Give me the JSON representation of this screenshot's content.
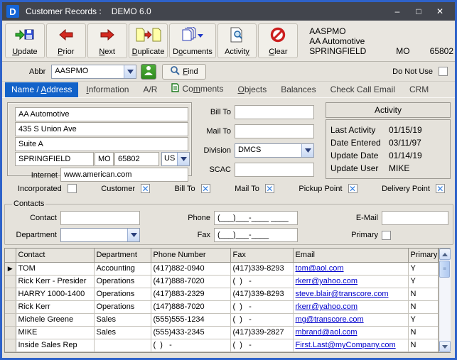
{
  "window": {
    "title": "Customer Records :",
    "product": "DEMO 6.0"
  },
  "titlebar_buttons": {
    "minimize": "–",
    "maximize": "□",
    "close": "✕"
  },
  "toolbar": {
    "buttons": [
      {
        "label": "Update"
      },
      {
        "label": "Prior"
      },
      {
        "label": "Next"
      },
      {
        "label": "Duplicate"
      },
      {
        "label": "Documents"
      },
      {
        "label": "Activity"
      },
      {
        "label": "Clear"
      }
    ],
    "record_info": {
      "abbr": "AASPMO",
      "name": "AA Automotive",
      "city": "SPRINGFIELD",
      "state": "MO",
      "zip": "65802"
    }
  },
  "abbr_bar": {
    "label": "Abbr",
    "value": "AASPMO",
    "find_label": "Find",
    "do_not_use_label": "Do Not Use",
    "do_not_use_checked": false
  },
  "tabs": [
    {
      "label": "Name / Address",
      "selected": true
    },
    {
      "label": "Information"
    },
    {
      "label": "A/R"
    },
    {
      "label": "Comments"
    },
    {
      "label": "Objects"
    },
    {
      "label": "Balances"
    },
    {
      "label": "Check Call Email"
    },
    {
      "label": "CRM"
    }
  ],
  "address": {
    "name": "AA Automotive",
    "line1": "435 S Union Ave",
    "line2": "Suite A",
    "city": "SPRINGFIELD",
    "state": "MO",
    "zip": "65802",
    "country": "US",
    "internet_label": "Internet",
    "internet": "www.american.com"
  },
  "details": {
    "bill_to_label": "Bill To",
    "bill_to": "",
    "mail_to_label": "Mail To",
    "mail_to": "",
    "division_label": "Division",
    "division": "DMCS",
    "scac_label": "SCAC",
    "scac": ""
  },
  "activity_panel": {
    "title": "Activity",
    "rows": [
      {
        "label": "Last Activity",
        "value": "01/15/19"
      },
      {
        "label": "Date Entered",
        "value": "03/11/97"
      },
      {
        "label": "Update Date",
        "value": "01/14/19"
      },
      {
        "label": "Update User",
        "value": "MIKE"
      }
    ]
  },
  "flags": [
    {
      "label": "Incorporated",
      "checked": false
    },
    {
      "label": "Customer",
      "checked": true
    },
    {
      "label": "Bill To",
      "checked": true
    },
    {
      "label": "Mail To",
      "checked": true
    },
    {
      "label": "Pickup  Point",
      "checked": true
    },
    {
      "label": "Delivery Point",
      "checked": true
    }
  ],
  "contacts_form": {
    "legend": "Contacts",
    "contact_label": "Contact",
    "contact": "",
    "phone_label": "Phone",
    "phone_mask": "(___)___-____ ____",
    "email_label": "E-Mail",
    "email": "",
    "department_label": "Department",
    "department": "",
    "fax_label": "Fax",
    "fax_mask": "(___)___-____",
    "primary_label": "Primary",
    "primary_checked": false
  },
  "contacts_table": {
    "columns": [
      "Contact",
      "Department",
      "Phone Number",
      "Fax",
      "Email",
      "Primary"
    ],
    "rows": [
      {
        "current": true,
        "contact": "TOM",
        "department": "Accounting",
        "phone": "(417)882-0940",
        "fax": "(417)339-8293",
        "email": "tom@aol.com",
        "primary": "Y"
      },
      {
        "current": false,
        "contact": "Rick Kerr - Presider",
        "department": "Operations",
        "phone": "(417)888-7020",
        "fax": "(  )   -",
        "email": "rkerr@yahoo.com",
        "primary": "Y"
      },
      {
        "current": false,
        "contact": "HARRY 1000-1400",
        "department": "Operations",
        "phone": "(417)883-2329",
        "fax": "(417)339-8293",
        "email": "steve.blair@transcore.com",
        "primary": "N"
      },
      {
        "current": false,
        "contact": "Rick Kerr",
        "department": "Operations",
        "phone": "(147)888-7020",
        "fax": "(  )   -",
        "email": "rkerr@yahoo.com",
        "primary": "N"
      },
      {
        "current": false,
        "contact": "Michele Greene",
        "department": "Sales",
        "phone": "(555)555-1234",
        "fax": "(  )   -",
        "email": "mg@transcore.com",
        "primary": "Y"
      },
      {
        "current": false,
        "contact": "MIKE",
        "department": "Sales",
        "phone": "(555)433-2345",
        "fax": "(417)339-2827",
        "email": "mbrand@aol.com",
        "primary": "N"
      },
      {
        "current": false,
        "contact": "Inside Sales Rep",
        "department": "",
        "phone": "(  )   -",
        "fax": "(  )   -",
        "email": "First.Last@myCompany.com",
        "primary": "N"
      }
    ]
  },
  "colors": {
    "accent_blue": "#1262c9",
    "check_blue": "#2f7de0",
    "link_blue": "#0000cc",
    "titlebar_gray": "#42454d",
    "window_border_blue": "#2e62c9"
  }
}
